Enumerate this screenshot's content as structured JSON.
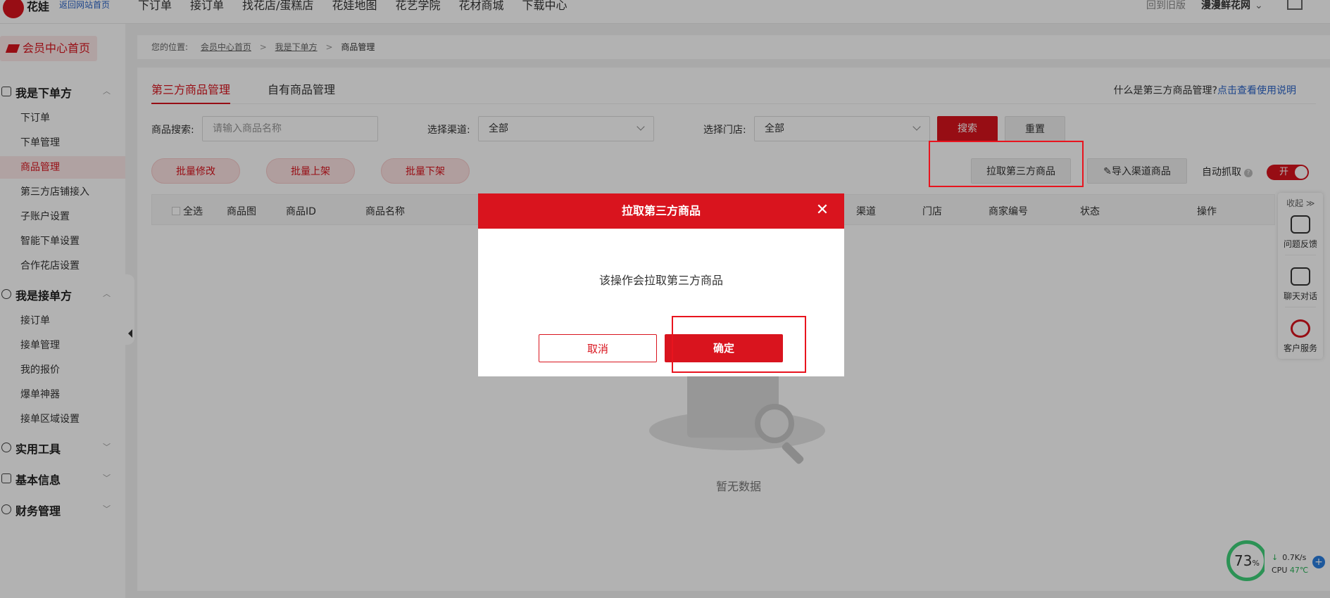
{
  "topbar": {
    "logo_text": "花娃",
    "home_link": "返回网站首页",
    "nav": [
      "下订单",
      "接订单",
      "找花店/蛋糕店",
      "花娃地图",
      "花艺学院",
      "花材商城",
      "下载中心"
    ],
    "old_version": "回到旧版",
    "user_name": "漫漫鲜花网"
  },
  "sidebar": {
    "home": "会员中心首页",
    "group_order": "我是下单方",
    "order_items": [
      "下订单",
      "下单管理",
      "商品管理",
      "第三方店铺接入",
      "子账户设置",
      "智能下单设置",
      "合作花店设置"
    ],
    "group_receive": "我是接单方",
    "receive_items": [
      "接订单",
      "接单管理",
      "我的报价",
      "爆单神器",
      "接单区域设置"
    ],
    "group_tools": "实用工具",
    "group_info": "基本信息",
    "group_finance": "财务管理"
  },
  "breadcrumb": {
    "prefix": "您的位置:",
    "home": "会员中心首页",
    "parent": "我是下单方",
    "current": "商品管理"
  },
  "tabs": {
    "third_party": "第三方商品管理",
    "own": "自有商品管理"
  },
  "help": {
    "question": "什么是第三方商品管理?",
    "link": "点击查看使用说明"
  },
  "filters": {
    "search_label": "商品搜索:",
    "search_placeholder": "请输入商品名称",
    "channel_label": "选择渠道:",
    "channel_value": "全部",
    "store_label": "选择门店:",
    "store_value": "全部",
    "search_btn": "搜索",
    "reset_btn": "重置"
  },
  "actions": {
    "batch_edit": "批量修改",
    "batch_on": "批量上架",
    "batch_off": "批量下架",
    "pull_third": "拉取第三方商品",
    "import_channel": "导入渠道商品",
    "auto_fetch": "自动抓取",
    "toggle_on": "开"
  },
  "table": {
    "select_all": "全选",
    "columns": [
      "商品图",
      "商品ID",
      "商品名称",
      "渠道",
      "门店",
      "商家编号",
      "状态",
      "操作"
    ]
  },
  "empty_text": "暂无数据",
  "float_panel": {
    "collapse": "收起 ≫",
    "feedback": "问题反馈",
    "chat": "聊天对话",
    "service": "客户服务"
  },
  "cpu_widget": {
    "percent": "73",
    "percent_unit": "%",
    "speed": "0.7K/s",
    "cpu_label": "CPU",
    "temp": "47℃"
  },
  "modal": {
    "title": "拉取第三方商品",
    "message": "该操作会拉取第三方商品",
    "cancel": "取消",
    "confirm": "确定"
  }
}
